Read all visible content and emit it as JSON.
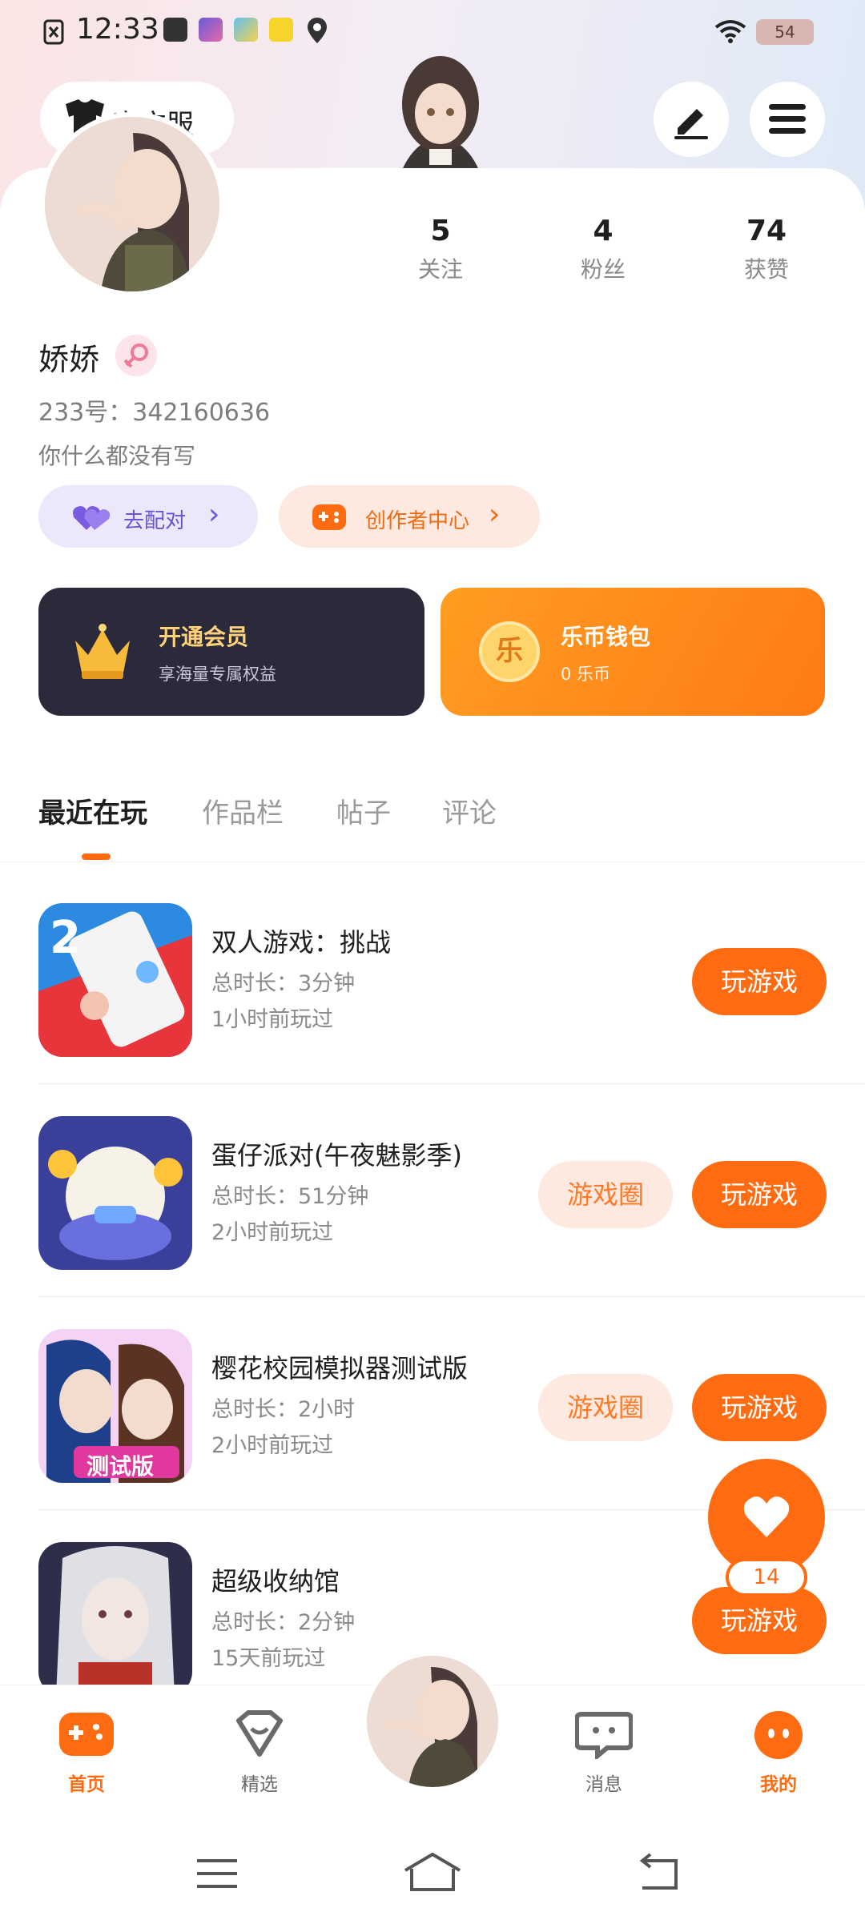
{
  "status_bar": {
    "time": "12:33",
    "battery": "54"
  },
  "header": {
    "server_label": "官方服"
  },
  "profile": {
    "stats": [
      {
        "num": "5",
        "label": "关注"
      },
      {
        "num": "4",
        "label": "粉丝"
      },
      {
        "num": "74",
        "label": "获赞"
      }
    ],
    "name": "娇娇",
    "uid": "233号：342160636",
    "bio": "你什么都没有写"
  },
  "chips": {
    "match": {
      "label": "去配对"
    },
    "creator": {
      "label": "创作者中心"
    }
  },
  "cards": {
    "vip": {
      "title": "开通会员",
      "sub": "享海量专属权益",
      "badge": ""
    },
    "coin": {
      "title": "乐币钱包",
      "sub": "0 乐币",
      "badge": "乐"
    }
  },
  "tabs": [
    "最近在玩",
    "作品栏",
    "帖子",
    "评论"
  ],
  "games": [
    {
      "name": "双人游戏：挑战",
      "duration": "总时长：3分钟",
      "last_played": "1小时前玩过",
      "has_circle": false,
      "play_label": "玩游戏",
      "circle_label": "游戏圈"
    },
    {
      "name": "蛋仔派对(午夜魅影季)",
      "duration": "总时长：51分钟",
      "last_played": "2小时前玩过",
      "has_circle": true,
      "play_label": "玩游戏",
      "circle_label": "游戏圈"
    },
    {
      "name": "樱花校园模拟器测试版",
      "duration": "总时长：2小时",
      "last_played": "2小时前玩过",
      "has_circle": true,
      "play_label": "玩游戏",
      "circle_label": "游戏圈",
      "icon_tag": "测试版"
    },
    {
      "name": "超级收纳馆",
      "duration": "总时长：2分钟",
      "last_played": "15天前玩过",
      "has_circle": false,
      "play_label": "玩游戏",
      "circle_label": "游戏圈"
    }
  ],
  "fab": {
    "count": "14"
  },
  "bottom_nav": [
    {
      "label": "首页",
      "active": true
    },
    {
      "label": "精选",
      "active": false
    },
    {
      "label": "消息",
      "active": false
    },
    {
      "label": "我的",
      "active": true
    }
  ],
  "colors": {
    "accent": "#ff6b10",
    "accent_light": "#fde9df",
    "vip_bg": "#2a2a3b",
    "vip_text": "#ffd27a"
  }
}
